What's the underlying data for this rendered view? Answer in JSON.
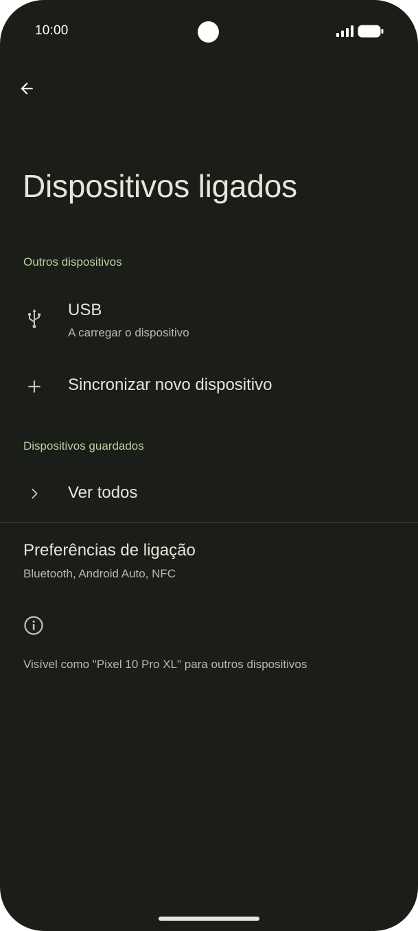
{
  "status_bar": {
    "time": "10:00",
    "signal_icon": "cellular-signal-icon",
    "battery_icon": "battery-full-icon"
  },
  "app_bar": {
    "back_icon": "arrow-back-icon"
  },
  "page": {
    "title": "Dispositivos ligados"
  },
  "sections": {
    "other_devices": {
      "header": "Outros dispositivos",
      "usb": {
        "icon": "usb-icon",
        "title": "USB",
        "subtitle": "A carregar o dispositivo"
      },
      "pair_new": {
        "icon": "plus-icon",
        "title": "Sincronizar novo dispositivo"
      }
    },
    "saved_devices": {
      "header": "Dispositivos guardados",
      "see_all": {
        "icon": "chevron-right-icon",
        "title": "Ver todos"
      }
    },
    "connection_preferences": {
      "title": "Preferências de ligação",
      "subtitle": "Bluetooth, Android Auto, NFC"
    },
    "footer": {
      "icon": "info-icon",
      "text": "Visível como \"Pixel 10 Pro XL\" para outros dispositivos"
    }
  },
  "colors": {
    "background": "#1b1e18",
    "accent": "#b8cfa0",
    "primary_text": "#e4e6d8",
    "secondary_text": "#b7b9ae"
  }
}
